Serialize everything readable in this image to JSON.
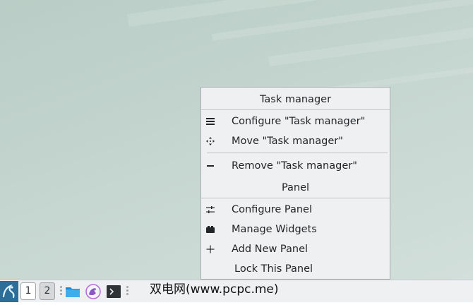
{
  "context_menu": {
    "task_manager_section": {
      "title": "Task manager",
      "items": [
        {
          "label": "Configure \"Task manager\"",
          "icon": "hamburger-icon"
        },
        {
          "label": "Move \"Task manager\"",
          "icon": "move-icon"
        },
        {
          "label": "Remove \"Task manager\"",
          "icon": "minus-icon"
        }
      ]
    },
    "panel_section": {
      "title": "Panel",
      "items": [
        {
          "label": "Configure Panel",
          "icon": "configure-icon"
        },
        {
          "label": "Manage Widgets",
          "icon": "widgets-icon"
        },
        {
          "label": "Add New Panel",
          "icon": "plus-icon"
        },
        {
          "label": "Lock This Panel",
          "icon": "lock-icon"
        }
      ]
    }
  },
  "taskbar": {
    "desktops": [
      "1",
      "2"
    ],
    "launchers": [
      "file-manager-icon",
      "browser-icon",
      "terminal-icon"
    ]
  },
  "watermark": {
    "text": "双电网(www.pcpc.me)"
  },
  "colors": {
    "launcher_bg": "#2c6e9a",
    "menu_bg": "#eff0f1",
    "folder_blue": "#1e88d6"
  }
}
